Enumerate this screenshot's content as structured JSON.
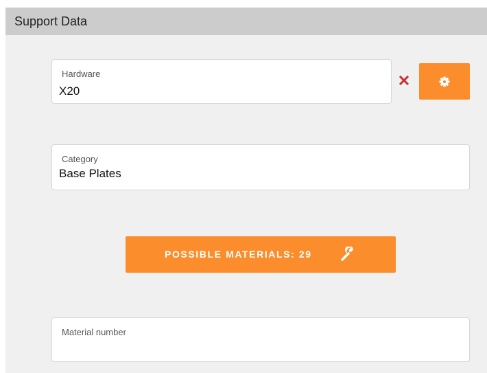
{
  "panel": {
    "title": "Support Data"
  },
  "hardware": {
    "label": "Hardware",
    "value": "X20",
    "clear_icon": "close-icon",
    "settings_icon": "gear-icon"
  },
  "category": {
    "label": "Category",
    "value": "Base Plates"
  },
  "materials_button": {
    "label": "POSSIBLE MATERIALS: 29",
    "icon": "wrench-icon"
  },
  "material_number": {
    "label": "Material number",
    "value": ""
  },
  "colors": {
    "accent": "#fb8d2c",
    "clear": "#c9302c",
    "header_bg": "#cccccc",
    "panel_bg": "#f0f0f0"
  }
}
